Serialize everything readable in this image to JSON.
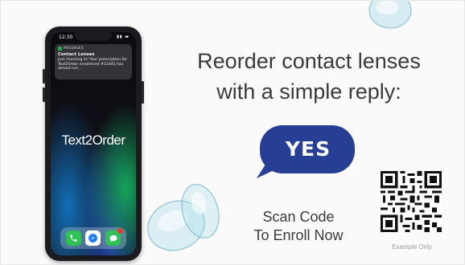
{
  "phone": {
    "status_time": "12:30",
    "notification": {
      "app_name": "MESSAGES",
      "title": "Contact Lenses",
      "body": "Just checking in! Your prescription for Text2Order enrollment #12345 has almost run..."
    },
    "brand": "Text2Order",
    "dock_apps": [
      "phone-icon",
      "safari-icon",
      "messages-icon"
    ]
  },
  "ad": {
    "headline_line1": "Reorder contact lenses",
    "headline_line2": "with a simple reply:",
    "reply_word": "YES",
    "cta_line1": "Scan Code",
    "cta_line2": "To Enroll Now",
    "qr_caption": "Example Only"
  },
  "colors": {
    "bubble": "#263f94",
    "text": "#3a3a3a",
    "caption": "#9a9a9a"
  }
}
